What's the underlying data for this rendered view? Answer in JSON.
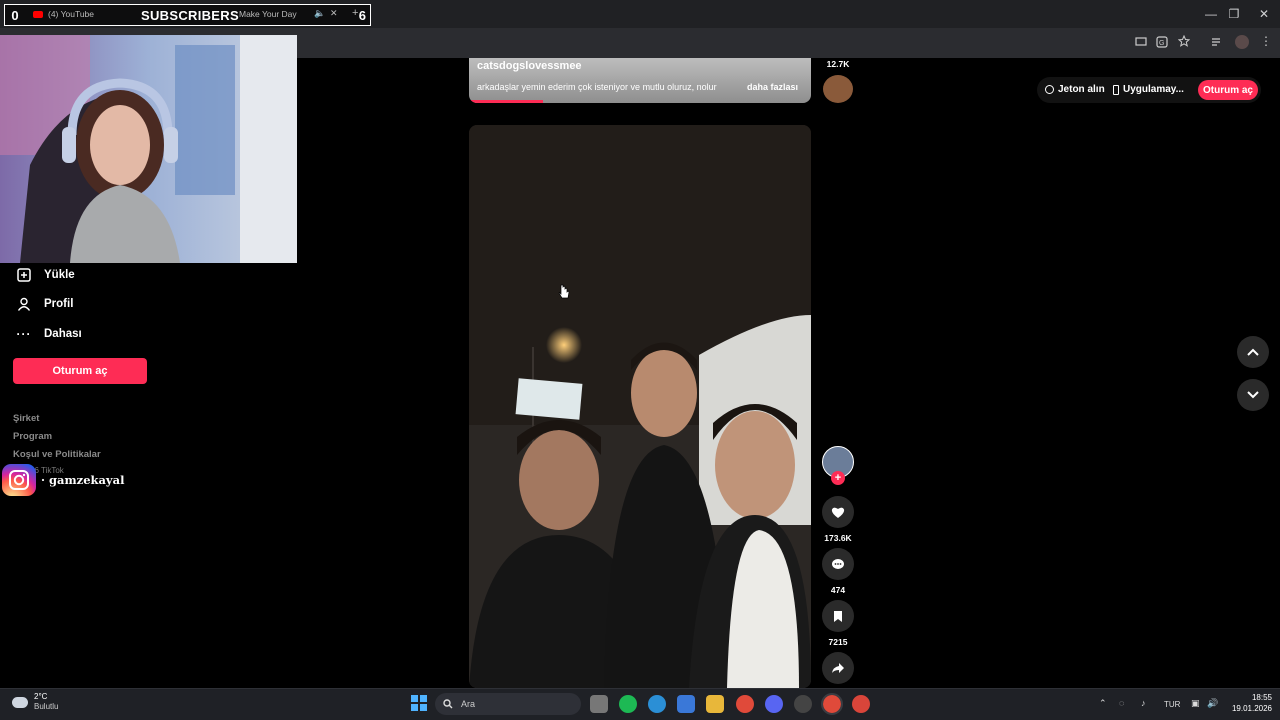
{
  "overlay": {
    "left_count": "0",
    "label": "SUBSCRIBERS",
    "right_count": "6",
    "tab_youtube": "(4) YouTube",
    "tab_make_day": "Make Your Day"
  },
  "sidebar": {
    "items": [
      {
        "label": "Yükle",
        "icon": "upload-plus-icon"
      },
      {
        "label": "Profil",
        "icon": "person-icon"
      },
      {
        "label": "Dahası",
        "icon": "more-dots-icon"
      }
    ],
    "login_label": "Oturum aç",
    "footer": [
      "Şirket",
      "Program",
      "Koşul ve Politikalar"
    ],
    "copyright": "© 2026 TikTok"
  },
  "instagram": {
    "handle": "· gamzekayal"
  },
  "top_actions": {
    "coins": "Jeton alın",
    "app": "Uygulamay...",
    "login": "Oturum aç"
  },
  "prev_video": {
    "author": "catsdogslovessmee",
    "caption": "arkadaşlar yemin ederim çok isteniyor ve mutlu oluruz, nolur",
    "more": "daha fazlası",
    "share_count": "12.7K"
  },
  "actions": {
    "likes": "173.6K",
    "comments": "474",
    "saves": "7215"
  },
  "taskbar": {
    "temp": "2°C",
    "weather": "Bulutlu",
    "search_placeholder": "Ara",
    "lang": "TUR",
    "time": "18:55",
    "date": "19.01.2026"
  },
  "colors": {
    "accent": "#fe2c55",
    "bg": "#000000"
  }
}
